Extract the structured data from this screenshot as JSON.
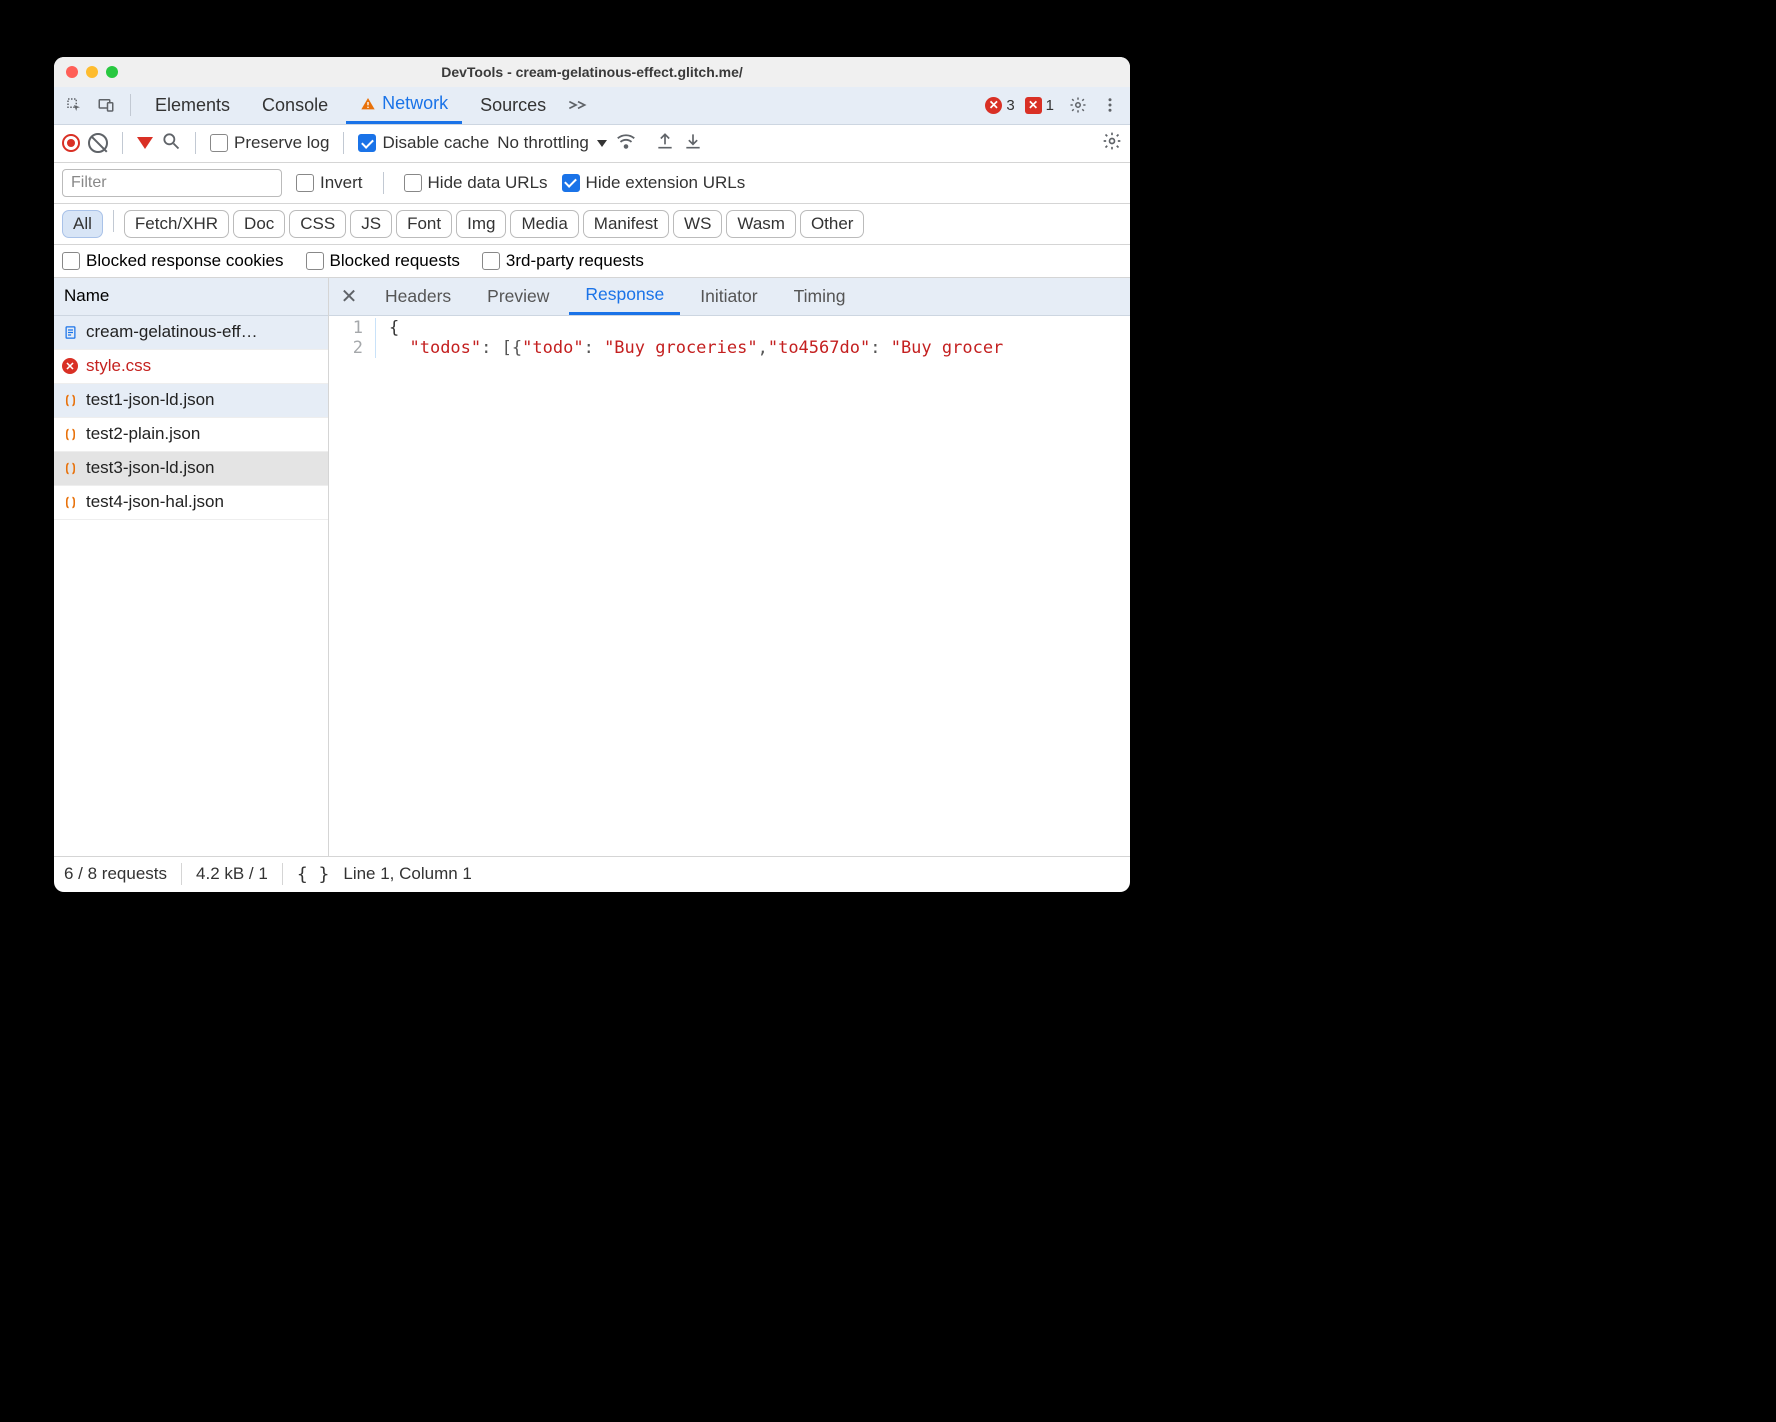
{
  "window_title": "DevTools - cream-gelatinous-effect.glitch.me/",
  "tabs": {
    "elements": "Elements",
    "console": "Console",
    "network": "Network",
    "sources": "Sources"
  },
  "error_counts": {
    "errors": "3",
    "issues": "1"
  },
  "toolbar": {
    "preserve_log": "Preserve log",
    "disable_cache": "Disable cache",
    "throttling": "No throttling"
  },
  "filters": {
    "placeholder": "Filter",
    "invert": "Invert",
    "hide_data_urls": "Hide data URLs",
    "hide_ext_urls": "Hide extension URLs"
  },
  "types": {
    "all": "All",
    "fetch": "Fetch/XHR",
    "doc": "Doc",
    "css": "CSS",
    "js": "JS",
    "font": "Font",
    "img": "Img",
    "media": "Media",
    "manifest": "Manifest",
    "ws": "WS",
    "wasm": "Wasm",
    "other": "Other"
  },
  "reqfilters": {
    "blocked_cookies": "Blocked response cookies",
    "blocked_requests": "Blocked requests",
    "third_party": "3rd-party requests"
  },
  "name_header": "Name",
  "requests": [
    {
      "name": "cream-gelatinous-eff…",
      "icon": "doc",
      "selected": true
    },
    {
      "name": "style.css",
      "icon": "err",
      "error": true
    },
    {
      "name": "test1-json-ld.json",
      "icon": "json",
      "selected": true
    },
    {
      "name": "test2-plain.json",
      "icon": "json"
    },
    {
      "name": "test3-json-ld.json",
      "icon": "json",
      "hover": true
    },
    {
      "name": "test4-json-hal.json",
      "icon": "json"
    }
  ],
  "detail_tabs": {
    "headers": "Headers",
    "preview": "Preview",
    "response": "Response",
    "initiator": "Initiator",
    "timing": "Timing"
  },
  "code": {
    "line1_num": "1",
    "line2_num": "2",
    "brace": "{",
    "key1": "\"todos\"",
    "colon": ":",
    "sp": " ",
    "lb": "[",
    "lc": "{",
    "key2": "\"todo\"",
    "val1": "\"Buy groceries\"",
    "comma": ",",
    "key3": "\"to4567do\"",
    "val2": "\"Buy grocer"
  },
  "status": {
    "requests": "6 / 8 requests",
    "size": "4.2 kB / 1",
    "cursor": "Line 1, Column 1"
  }
}
